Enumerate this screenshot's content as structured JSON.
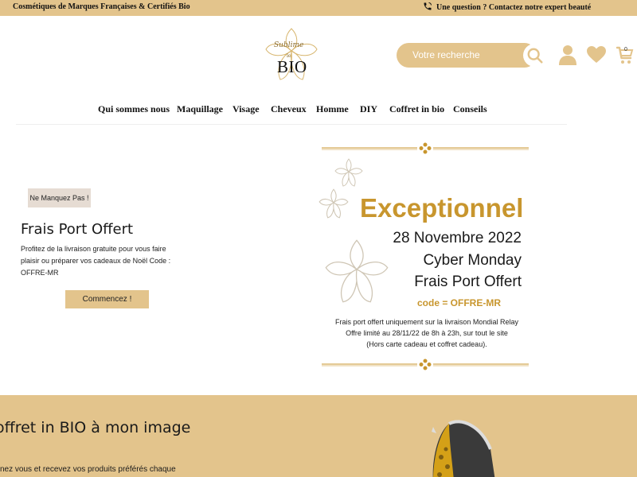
{
  "topbar": {
    "tagline": "Cosmétiques de Marques Françaises & Certifiés Bio",
    "contact": "Une question ? Contactez notre expert beauté"
  },
  "logo": {
    "script": "Sublime",
    "sub": "le",
    "brand": "BIO"
  },
  "search": {
    "placeholder": "Votre recherche"
  },
  "header_icons": [
    "account-icon",
    "heart-icon",
    "cart-icon"
  ],
  "cart": {
    "count": "0"
  },
  "nav": {
    "items": [
      "Qui sommes nous",
      "Maquillage",
      "Visage",
      "Cheveux",
      "Homme",
      "DIY",
      "Coffret in bio",
      "Conseils"
    ]
  },
  "promo": {
    "tag": "Ne Manquez Pas !",
    "title": "Frais Port Offert",
    "text": "Profitez de la livraison gratuite pour vous faire plaisir ou préparer vos cadeaux de Noël Code : OFFRE-MR",
    "button": "Commencez !"
  },
  "banner": {
    "headline": "Exceptionnel",
    "date": "28 Novembre 2022",
    "event": "Cyber Monday",
    "offer": "Frais Port Offert",
    "code": "code = OFFRE-MR",
    "details": [
      "Frais port offert uniquement sur la livraison Mondial Relay",
      "Offre limité au 28/11/22 de 8h à 23h, sur tout le site",
      "(Hors carte cadeau et coffret cadeau)."
    ]
  },
  "bottom": {
    "title": "offret in BIO à mon image",
    "text": "nez vous et recevez vos produits préférés chaque"
  },
  "colors": {
    "accent": "#e3c48c",
    "gold_text": "#c8962e",
    "tag_bg": "#e6dcd3"
  }
}
